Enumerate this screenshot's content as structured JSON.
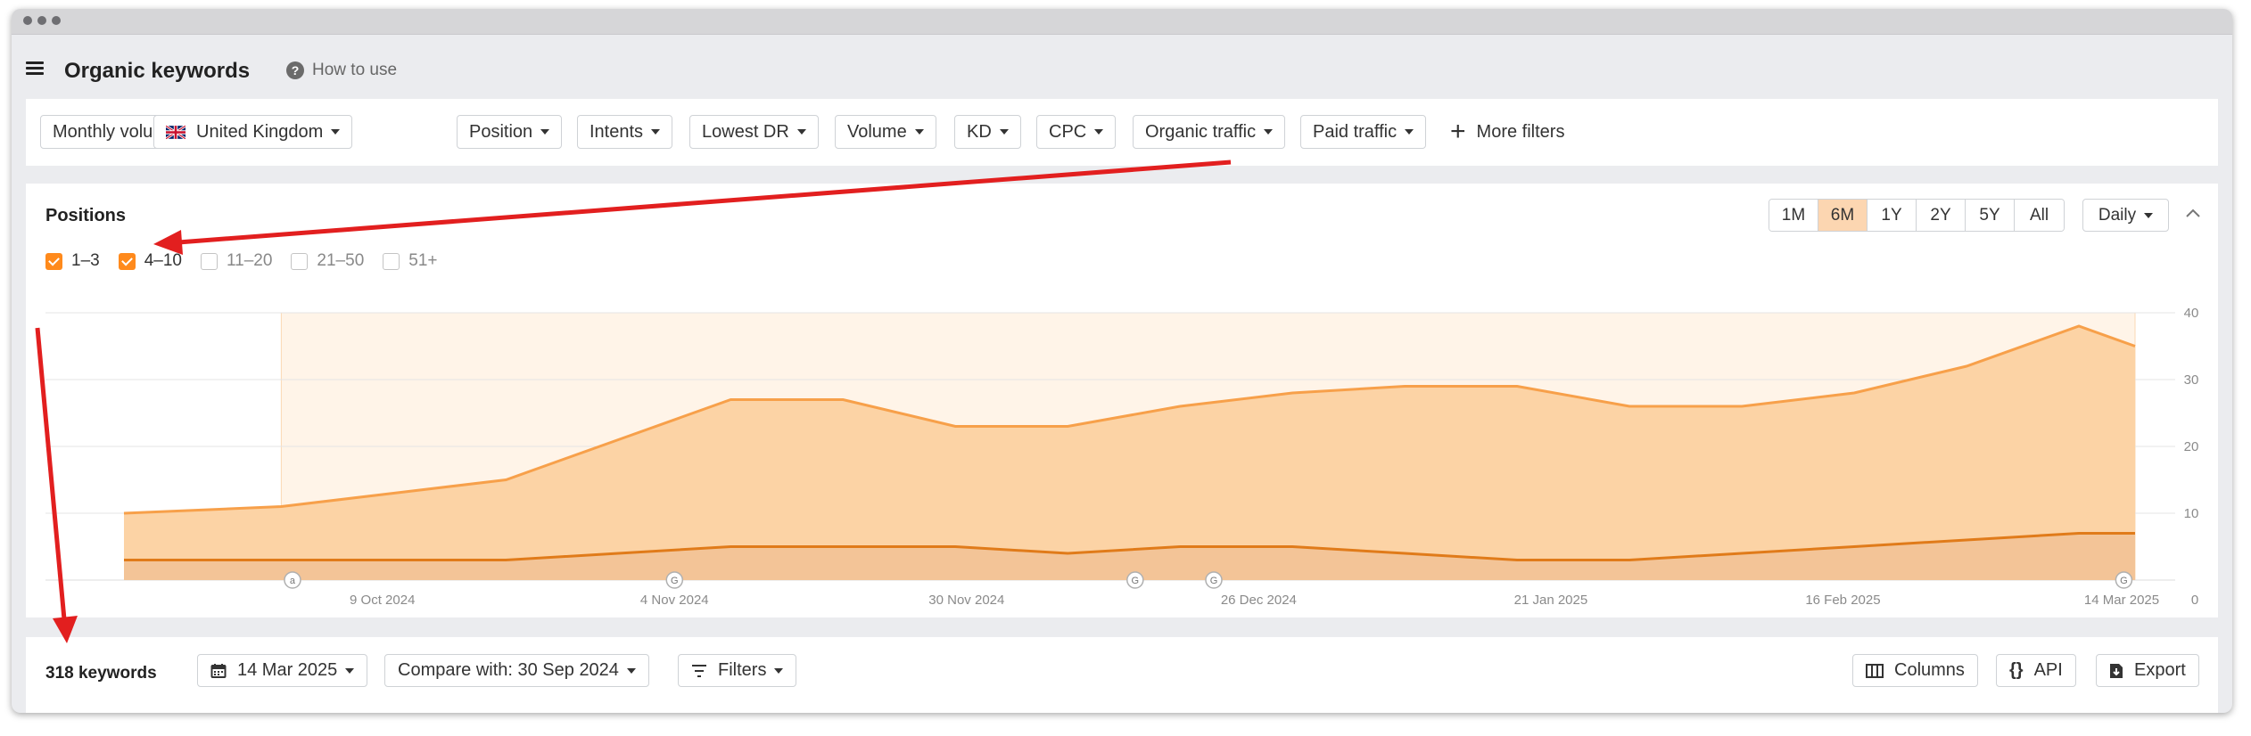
{
  "header": {
    "title": "Organic keywords",
    "help_label": "How to use"
  },
  "filters": [
    {
      "label": "Monthly volume"
    },
    {
      "label": "United Kingdom",
      "icon": "uk-flag-icon"
    },
    {
      "label": "Position"
    },
    {
      "label": "Intents"
    },
    {
      "label": "Lowest DR"
    },
    {
      "label": "Volume"
    },
    {
      "label": "KD"
    },
    {
      "label": "CPC"
    },
    {
      "label": "Organic traffic"
    },
    {
      "label": "Paid traffic"
    }
  ],
  "more_filters_label": "More filters",
  "positions_panel": {
    "title": "Positions",
    "legend": [
      {
        "label": "1–3",
        "checked": true
      },
      {
        "label": "4–10",
        "checked": true
      },
      {
        "label": "11–20",
        "checked": false
      },
      {
        "label": "21–50",
        "checked": false
      },
      {
        "label": "51+",
        "checked": false
      }
    ],
    "ranges": [
      "1M",
      "6M",
      "1Y",
      "2Y",
      "5Y",
      "All"
    ],
    "active_range": "6M",
    "interval_label": "Daily"
  },
  "chart_data": {
    "type": "area",
    "stacked": true,
    "x_tick_labels": [
      "9 Oct 2024",
      "4 Nov 2024",
      "30 Nov 2024",
      "26 Dec 2024",
      "21 Jan 2025",
      "16 Feb 2025",
      "14 Mar 2025"
    ],
    "y_tick_labels": [
      "40",
      "30",
      "20",
      "10",
      "0"
    ],
    "ylim": [
      0,
      40
    ],
    "grid": true,
    "annotation_markers": [
      "a",
      "G",
      "G",
      "G",
      "G"
    ],
    "x": [
      "2024-09-16",
      "2024-09-30",
      "2024-10-10",
      "2024-10-20",
      "2024-10-30",
      "2024-11-09",
      "2024-11-19",
      "2024-11-29",
      "2024-12-09",
      "2024-12-19",
      "2024-12-29",
      "2025-01-08",
      "2025-01-18",
      "2025-01-28",
      "2025-02-07",
      "2025-02-17",
      "2025-02-27",
      "2025-03-09",
      "2025-03-14"
    ],
    "series": [
      {
        "name": "1–3",
        "color": "#e07b1a",
        "values": [
          3,
          3,
          3,
          3,
          4,
          5,
          5,
          5,
          4,
          5,
          5,
          4,
          3,
          3,
          4,
          5,
          6,
          7,
          7
        ]
      },
      {
        "name": "4–10",
        "color": "#f7a04a",
        "values": [
          7,
          8,
          10,
          12,
          17,
          22,
          22,
          18,
          19,
          21,
          23,
          25,
          26,
          23,
          22,
          23,
          26,
          31,
          28
        ]
      }
    ]
  },
  "bottom_bar": {
    "keyword_count": "318 keywords",
    "date_label": "14 Mar 2025",
    "compare_label": "Compare with: 30 Sep 2024",
    "filters_label": "Filters",
    "columns_label": "Columns",
    "api_label": "API",
    "export_label": "Export"
  }
}
